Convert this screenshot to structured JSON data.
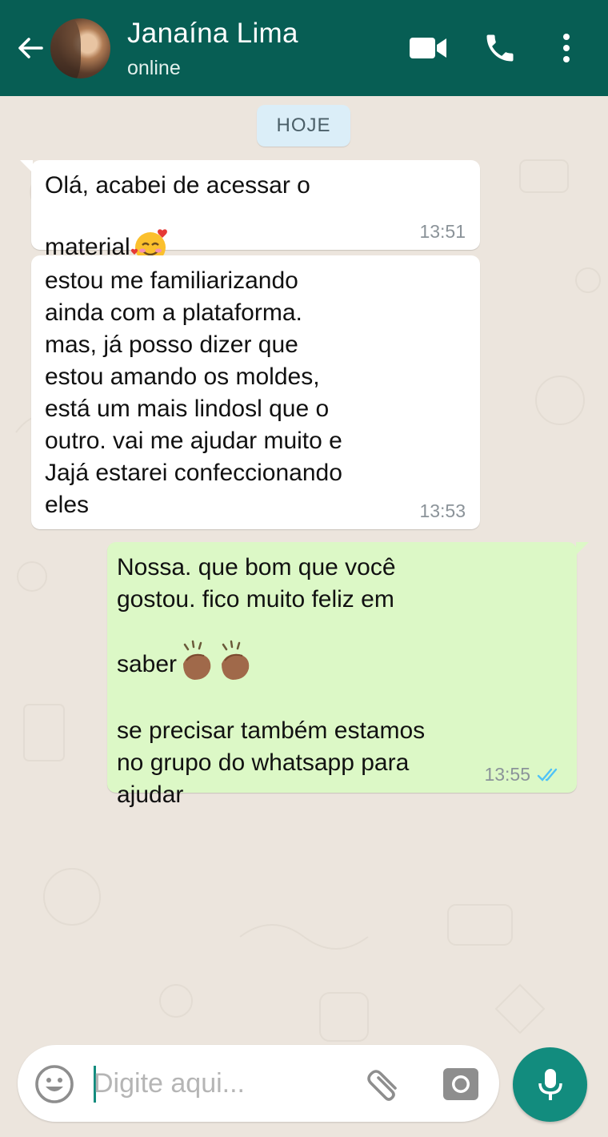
{
  "header": {
    "contact_name": "Janaína Lima",
    "status": "online"
  },
  "chat": {
    "date_label": "HOJE",
    "messages": [
      {
        "direction": "incoming",
        "text": "Olá, acabei de acessar o\nmaterial",
        "emoji": "smiling-face-with-hearts",
        "time": "13:51"
      },
      {
        "direction": "incoming",
        "text": "estou me familiarizando\nainda com a plataforma.\nmas, já posso dizer que\nestou amando os moldes,\nestá um mais lindosl que o\noutro. vai me ajudar muito e\nJajá estarei confeccionando\neles",
        "time": "13:53"
      },
      {
        "direction": "outgoing",
        "text_line1": "Nossa. que bom que você\ngostou. fico muito feliz em\nsaber",
        "emoji": "clapping-hands-x2",
        "text_line2": "se precisar também estamos\nno grupo do whatsapp para\najudar",
        "time": "13:55",
        "status": "read"
      }
    ]
  },
  "composer": {
    "placeholder": "Digite aqui..."
  },
  "colors": {
    "header": "#075e54",
    "accent": "#128c7e",
    "outgoing_bubble": "#dcf8c6",
    "incoming_bubble": "#ffffff",
    "read_ticks": "#4fc3f7"
  }
}
